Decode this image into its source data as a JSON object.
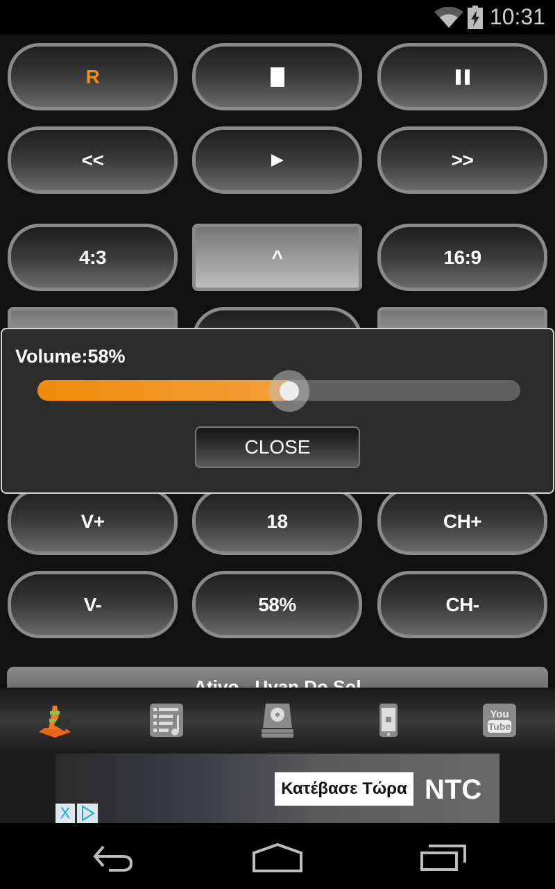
{
  "status_bar": {
    "time": "10:31",
    "wifi_icon": "wifi-icon",
    "battery_icon": "battery-charging-icon"
  },
  "remote": {
    "rows": [
      [
        {
          "label": "R",
          "name": "record",
          "accent": "#f0900e"
        },
        {
          "label": "stop",
          "name": "stop",
          "icon": "stop-icon"
        },
        {
          "label": "pause",
          "name": "pause",
          "icon": "pause-icon"
        }
      ],
      [
        {
          "label": "<<",
          "name": "rewind"
        },
        {
          "label": "play",
          "name": "play",
          "icon": "play-icon"
        },
        {
          "label": ">>",
          "name": "fast-forward"
        }
      ],
      [
        {
          "label": "4:3",
          "name": "aspect-4-3"
        },
        {
          "label": "^",
          "name": "up",
          "pressed": true
        },
        {
          "label": "16:9",
          "name": "aspect-16-9"
        }
      ],
      [
        {
          "label": "V+",
          "name": "volume-up"
        },
        {
          "label": "18",
          "name": "channel-number"
        },
        {
          "label": "CH+",
          "name": "channel-up"
        }
      ],
      [
        {
          "label": "V-",
          "name": "volume-down"
        },
        {
          "label": "58%",
          "name": "volume-level"
        },
        {
          "label": "CH-",
          "name": "channel-down"
        }
      ]
    ]
  },
  "volume_dialog": {
    "label": "Volume:58%",
    "value_percent": 58,
    "close_label": "CLOSE",
    "accent": "#f08a0a"
  },
  "now_playing": {
    "text": "Ativo - Uyan Do Sol"
  },
  "toolbar": {
    "items": [
      {
        "name": "vlc-app-icon"
      },
      {
        "name": "playlist-icon"
      },
      {
        "name": "disk-drive-icon"
      },
      {
        "name": "phone-remote-icon"
      },
      {
        "name": "youtube-icon",
        "label_top": "You",
        "label_bottom": "Tube"
      }
    ]
  },
  "ad": {
    "cta": "Κατέβασε Τώρα",
    "brand": "NTC",
    "close": "X"
  },
  "nav_bar": {
    "back": "back-icon",
    "home": "home-icon",
    "recents": "recents-icon"
  }
}
